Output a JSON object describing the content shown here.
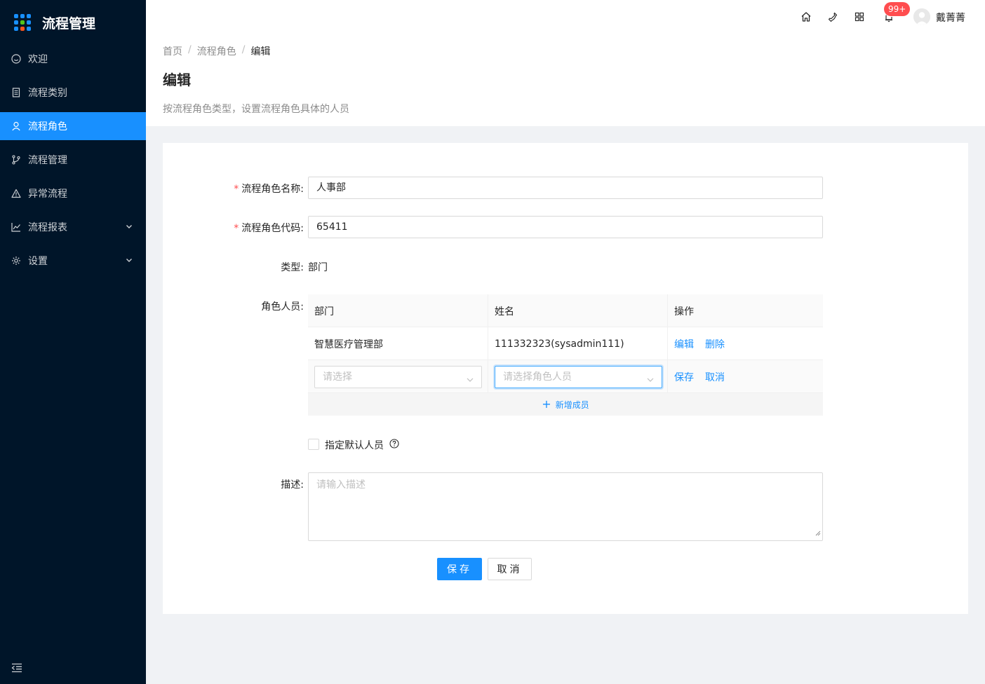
{
  "app": {
    "title": "流程管理",
    "logo_colors": [
      "#1890ff",
      "#1890ff",
      "#1890ff",
      "#1890ff",
      "#52c41a",
      "#1890ff",
      "#1890ff",
      "#fa541c",
      "#1890ff"
    ]
  },
  "sidebar": {
    "items": [
      {
        "label": "欢迎",
        "icon": "smile-icon"
      },
      {
        "label": "流程类别",
        "icon": "file-icon"
      },
      {
        "label": "流程角色",
        "icon": "user-icon",
        "active": true
      },
      {
        "label": "流程管理",
        "icon": "branch-icon"
      },
      {
        "label": "异常流程",
        "icon": "warning-icon"
      },
      {
        "label": "流程报表",
        "icon": "chart-icon",
        "has_submenu": true
      },
      {
        "label": "设置",
        "icon": "gear-icon",
        "has_submenu": true
      }
    ]
  },
  "header": {
    "notification_count": "99+",
    "username": "戴菁菁"
  },
  "breadcrumb": [
    "首页",
    "流程角色",
    "编辑"
  ],
  "page": {
    "title": "编辑",
    "description": "按流程角色类型，设置流程角色具体的人员"
  },
  "form": {
    "name_label": "流程角色名称:",
    "name_value": "人事部",
    "code_label": "流程角色代码:",
    "code_value": "65411",
    "type_label": "类型:",
    "type_value": "部门",
    "members_label": "角色人员:",
    "table": {
      "headers": [
        "部门",
        "姓名",
        "操作"
      ],
      "rows": [
        {
          "dept": "智慧医疗管理部",
          "name": "111332323(sysadmin111)",
          "actions": [
            "编辑",
            "删除"
          ]
        }
      ],
      "edit_row": {
        "dept_placeholder": "请选择",
        "name_placeholder": "请选择角色人员",
        "actions": [
          "保存",
          "取消"
        ]
      },
      "add_label": "新增成员"
    },
    "default_member_label": "指定默认人员",
    "desc_label": "描述:",
    "desc_placeholder": "请输入描述",
    "save_button": "保存",
    "cancel_button": "取消"
  }
}
